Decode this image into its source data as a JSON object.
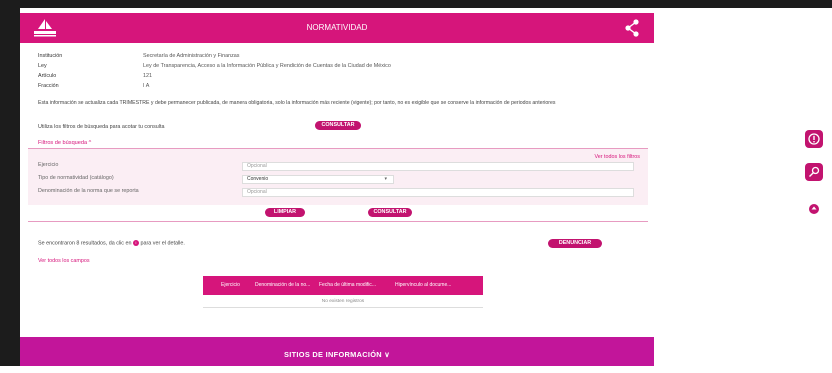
{
  "header": {
    "title": "NORMATIVIDAD"
  },
  "info": [
    {
      "label": "Institución",
      "value": "Secretaría de Administración y Finanzas"
    },
    {
      "label": "Ley",
      "value": "Ley de Transparencia, Acceso a la Información Pública y Rendición de Cuentas de la Ciudad de México"
    },
    {
      "label": "Artículo",
      "value": "121"
    },
    {
      "label": "Fracción",
      "value": "I A"
    }
  ],
  "note": "Esta información se actualiza cada TRIMESTRE y debe permanecer publicada, de manera obligatoria, solo la información más reciente (vigente); por tanto, no es exigible que se conserve la información de periodos anteriores",
  "hint": "Utiliza los filtros de búsqueda para acotar tu consulta",
  "consult_label": "CONSULTAR",
  "filters": {
    "toggle_label": "Filtros de búsqueda ^",
    "ver_todos": "Ver todos los filtros",
    "ejercicio_label": "Ejercicio",
    "ejercicio_placeholder": "Opcional",
    "tipo_label": "Tipo de normatividad (catálogo)",
    "tipo_value": "Convenio",
    "denominacion_label": "Denominación de la norma que se reporta",
    "denominacion_placeholder": "Opcional"
  },
  "actions": {
    "limpiar": "LIMPIAR",
    "consultar": "CONSULTAR"
  },
  "results": {
    "text_before": "Se encontraron 8 resultados, da clic en",
    "text_after": "para ver el detalle.",
    "denunciar": "DENUNCIAR",
    "ver_campos": "Ver todos los campos"
  },
  "table": {
    "columns": [
      "Ejercicio",
      "Denominación de la no...",
      "Fecha de última modific...",
      "Hipervínculo al docume..."
    ],
    "empty": "No existen registros"
  },
  "footer": {
    "title": "SITIOS DE INFORMACIÓN ∨"
  },
  "colors": {
    "brand": "#d6157b",
    "footer": "#c2159a"
  }
}
